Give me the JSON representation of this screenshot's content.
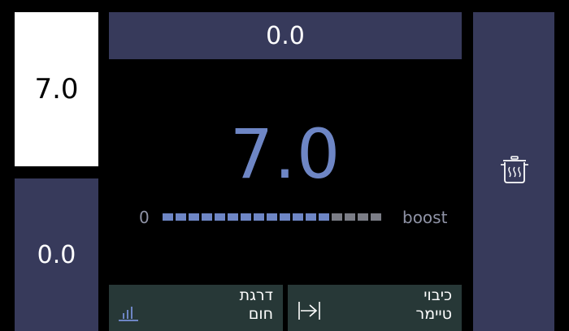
{
  "left_top": {
    "value": "7.0"
  },
  "left_bottom": {
    "value": "0.0"
  },
  "top_bar": {
    "value": "0.0"
  },
  "main": {
    "value": "7.0"
  },
  "level": {
    "min_label": "0",
    "max_label": "boost",
    "segments_total": 17,
    "segments_active": 13
  },
  "buttons": {
    "power_level": {
      "line1": "דרגת",
      "line2": "חום",
      "icon": "bar-chart-icon"
    },
    "off_timer": {
      "line1": "כיבוי",
      "line2": "טיימר",
      "icon": "arrow-to-line-icon"
    }
  },
  "right_panel": {
    "icon": "pot-icon"
  },
  "colors": {
    "panel": "#373a5b",
    "accent": "#6e86c5",
    "button": "#273837",
    "inactive_segment": "#7b7d86"
  }
}
